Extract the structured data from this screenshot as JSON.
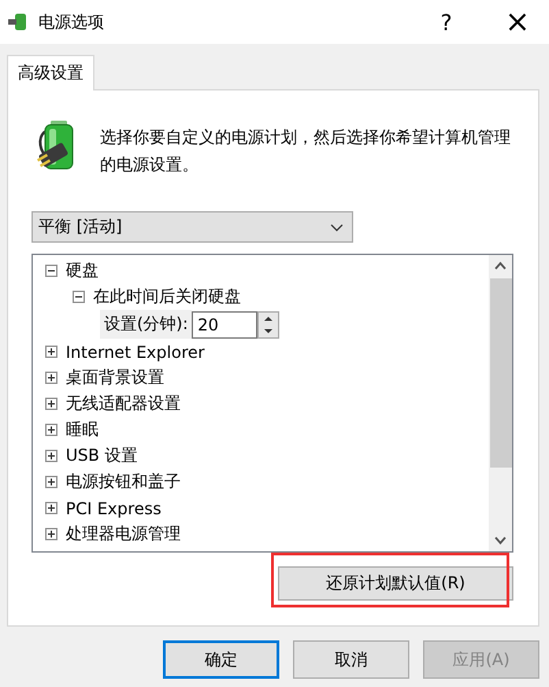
{
  "window": {
    "title": "电源选项",
    "help": "?",
    "close": "×"
  },
  "tabs": [
    {
      "label": "高级设置",
      "selected": true
    }
  ],
  "description": "选择你要自定义的电源计划，然后选择你希望计算机管理的电源设置。",
  "plan_dropdown": {
    "value": "平衡 [活动]"
  },
  "tree": [
    {
      "kind": "group",
      "label": "硬盘",
      "expanded": true,
      "children": [
        {
          "kind": "group",
          "label": "在此时间后关闭硬盘",
          "expanded": true,
          "children": [
            {
              "kind": "setting",
              "label": "设置(分钟):",
              "value": "20"
            }
          ]
        }
      ]
    },
    {
      "kind": "group",
      "label": "Internet Explorer",
      "expanded": false
    },
    {
      "kind": "group",
      "label": "桌面背景设置",
      "expanded": false
    },
    {
      "kind": "group",
      "label": "无线适配器设置",
      "expanded": false
    },
    {
      "kind": "group",
      "label": "睡眠",
      "expanded": false
    },
    {
      "kind": "group",
      "label": "USB 设置",
      "expanded": false
    },
    {
      "kind": "group",
      "label": "电源按钮和盖子",
      "expanded": false
    },
    {
      "kind": "group",
      "label": "PCI Express",
      "expanded": false
    },
    {
      "kind": "group",
      "label": "处理器电源管理",
      "expanded": false
    }
  ],
  "restore_button": {
    "label": "还原计划默认值(R)",
    "highlighted": true
  },
  "buttons": [
    {
      "label": "确定",
      "default": true,
      "disabled": false
    },
    {
      "label": "取消",
      "default": false,
      "disabled": false
    },
    {
      "label": "应用(A)",
      "default": false,
      "disabled": true
    }
  ]
}
